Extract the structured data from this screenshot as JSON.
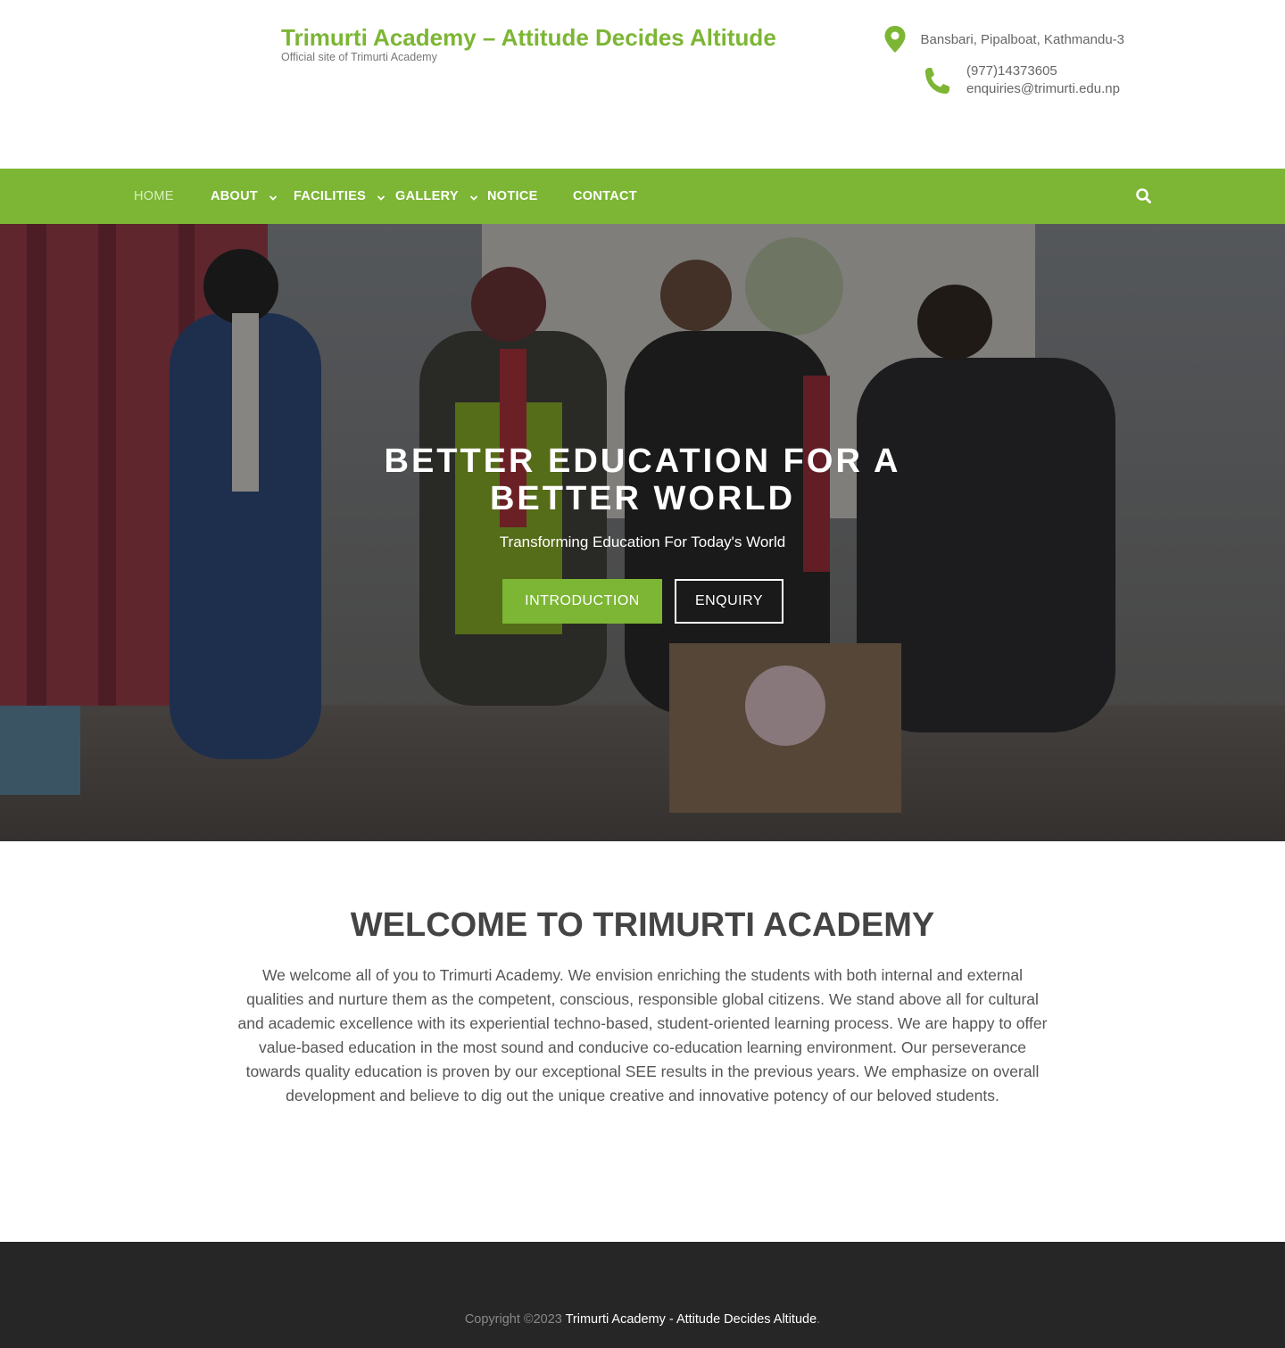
{
  "header": {
    "site_title": "Trimurti Academy – Attitude Decides Altitude",
    "tagline": "Official site of Trimurti Academy",
    "address": "Bansbari, Pipalboat, Kathmandu-3",
    "phone": "(977)14373605",
    "email": "enquiries@trimurti.edu.np",
    "accent_color": "#7cb634"
  },
  "nav": {
    "items": [
      {
        "label": "HOME",
        "active": true,
        "has_dropdown": false
      },
      {
        "label": "ABOUT",
        "active": false,
        "has_dropdown": true
      },
      {
        "label": "FACILITIES",
        "active": false,
        "has_dropdown": true
      },
      {
        "label": "GALLERY",
        "active": false,
        "has_dropdown": true
      },
      {
        "label": "NOTICE",
        "active": false,
        "has_dropdown": false
      },
      {
        "label": "CONTACT",
        "active": false,
        "has_dropdown": false
      }
    ],
    "search_icon": "search-icon"
  },
  "hero": {
    "title_line1": "BETTER EDUCATION FOR A",
    "title_line2": "BETTER WORLD",
    "subtitle": "Transforming Education For Today's World",
    "btn_intro": "INTRODUCTION",
    "btn_enquiry": "ENQUIRY"
  },
  "welcome": {
    "title": "WELCOME TO TRIMURTI ACADEMY",
    "text": "We welcome all of you to Trimurti Academy. We envision enriching the students with both internal and external qualities and nurture them as the competent, conscious, responsible global citizens. We stand above all for cultural and academic excellence with its experiential techno-based, student-oriented learning process. We are happy to offer value-based education in the most sound and conducive co-education learning environment.  Our perseverance towards quality education is proven by our exceptional SEE results in the previous years. We emphasize on overall development and believe to dig out the unique creative and innovative potency of our beloved students."
  },
  "footer": {
    "copyright": "Copyright ©2023",
    "site_link": "Trimurti Academy - Attitude Decides Altitude",
    "period": "."
  }
}
